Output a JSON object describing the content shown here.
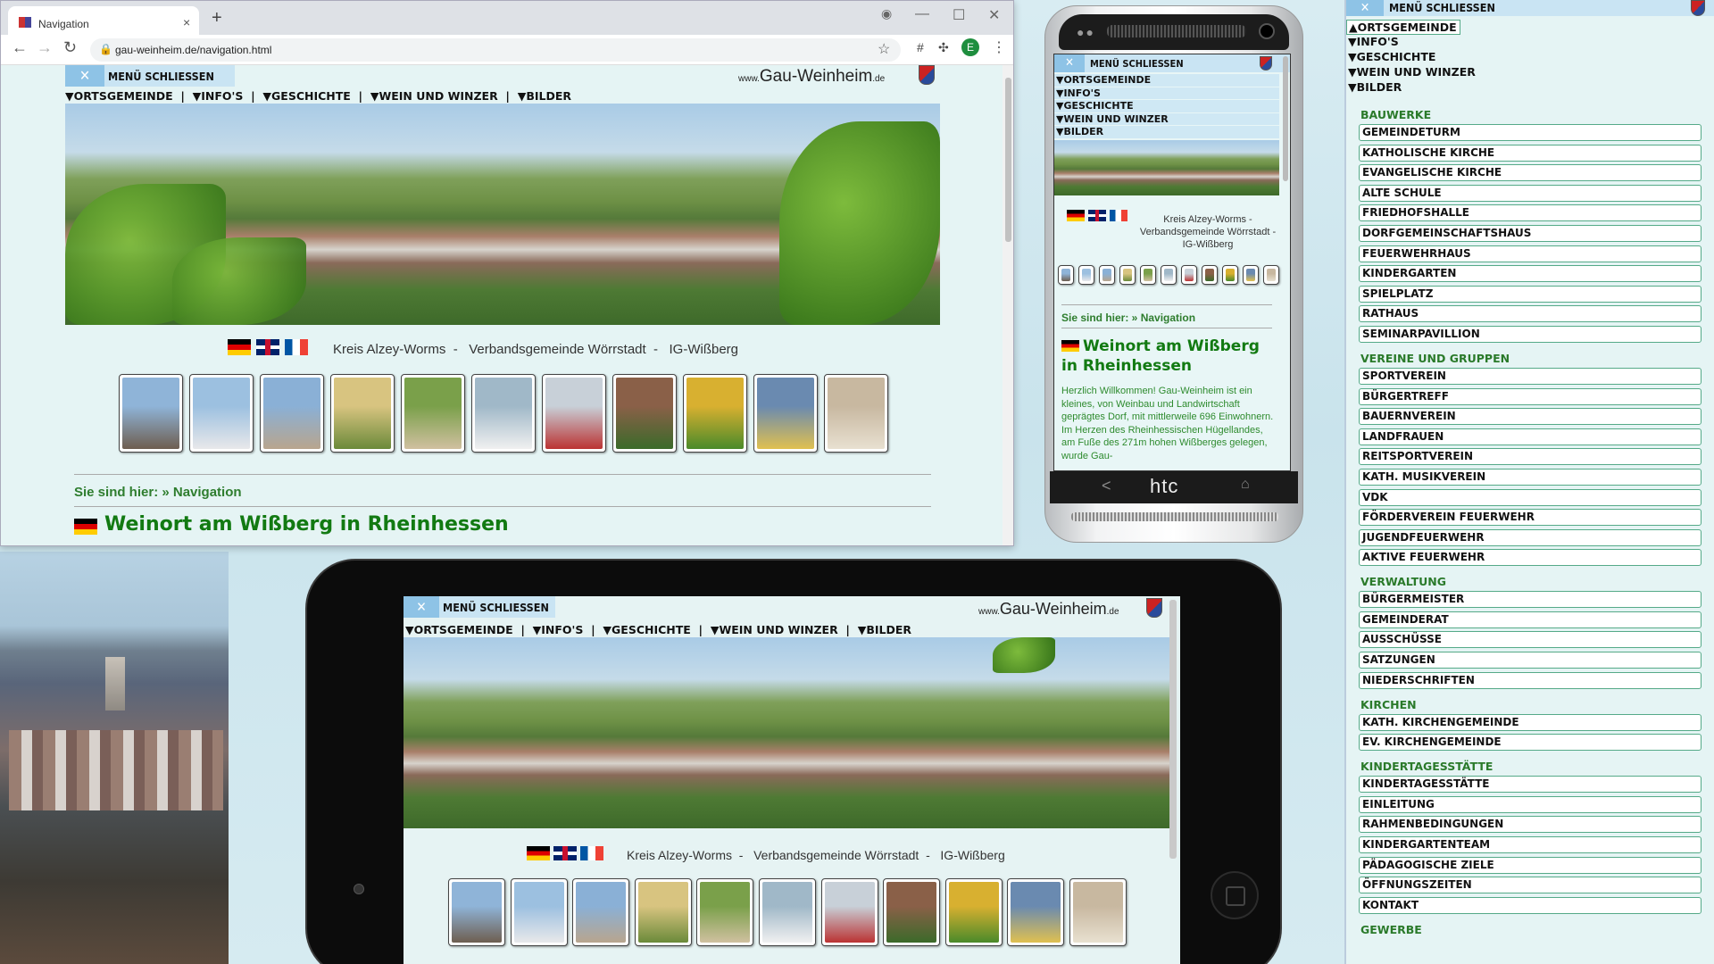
{
  "browser": {
    "tab_title": "Navigation",
    "new_tab": "+",
    "close_tab": "×",
    "url": "gau-weinheim.de/navigation.html",
    "avatar_letter": "E",
    "window_controls": [
      "—",
      "☐",
      "✕"
    ]
  },
  "site": {
    "menu_close": "MENÜ SCHLIESSEN",
    "close_x": "✕",
    "logo_prefix": "www.",
    "logo_name": "Gau-Weinheim",
    "logo_suffix": ".de",
    "nav": [
      "▼ORTSGEMEINDE",
      "|",
      "▼INFO'S",
      "|",
      "▼GESCHICHTE",
      "|",
      "▼WEIN UND WINZER",
      "|",
      "▼BILDER"
    ],
    "region_line": "Kreis Alzey-Worms  -   Verbandsgemeinde Wörrstadt  -   IG-Wißberg",
    "breadcrumb": "Sie sind hier: » Navigation",
    "headline": "Weinort am Wißberg in Rheinhessen",
    "intro": "Herzlich Willkommen! Gau-Weinheim ist ein kleines, von Weinbau und Landwirtschaft geprägtes Dorf, mit mittlerweile 696 Einwohnern. Im Herzen des Rheinhessischen Hügellandes, am Fuße des 271m hohen Wißberges gelegen, wurde Gau-"
  },
  "phone": {
    "nav": [
      "▼ORTSGEMEINDE",
      "▼INFO'S",
      "▼GESCHICHTE",
      "▼WEIN UND WINZER",
      "▼BILDER"
    ],
    "region_line": "Kreis Alzey-Worms  -  Verbandsgemeinde Wörrstadt  -  IG-Wißberg",
    "headline": "Weinort am Wißberg in Rheinhessen",
    "brand": "htc",
    "back": "<",
    "home": "⌂"
  },
  "menu_panel": {
    "close_label": "MENÜ SCHLIESSEN",
    "top_nav": [
      "▲ORTSGEMEINDE",
      "▼INFO'S",
      "▼GESCHICHTE",
      "▼WEIN UND WINZER",
      "▼BILDER"
    ],
    "sections": [
      {
        "title": "BAUWERKE",
        "items": [
          "GEMEINDETURM",
          "KATHOLISCHE KIRCHE",
          "EVANGELISCHE KIRCHE",
          "ALTE SCHULE",
          "FRIEDHOFSHALLE",
          "DORFGEMEINSCHAFTSHAUS",
          "FEUERWEHRHAUS",
          "KINDERGARTEN",
          "SPIELPLATZ",
          "RATHAUS",
          "SEMINARPAVILLION"
        ]
      },
      {
        "title": "VEREINE UND GRUPPEN",
        "items": [
          "SPORTVEREIN",
          "BÜRGERTREFF",
          "BAUERNVEREIN",
          "LANDFRAUEN",
          "REITSPORTVEREIN",
          "KATH. MUSIKVEREIN",
          "VDK",
          "FÖRDERVEREIN FEUERWEHR",
          "JUGENDFEUERWEHR",
          "AKTIVE FEUERWEHR"
        ]
      },
      {
        "title": "VERWALTUNG",
        "items": [
          "BÜRGERMEISTER",
          "GEMEINDERAT",
          "AUSSCHÜSSE",
          "SATZUNGEN",
          "NIEDERSCHRIFTEN"
        ]
      },
      {
        "title": "KIRCHEN",
        "items": [
          "KATH. KIRCHENGEMEINDE",
          "EV. KIRCHENGEMEINDE"
        ]
      },
      {
        "title": "KINDERTAGESSTÄTTE",
        "items": [
          "KINDERTAGESSTÄTTE",
          "EINLEITUNG",
          "RAHMENBEDINGUNGEN",
          "KINDERGARTENTEAM",
          "PÄDAGOGISCHE ZIELE",
          "ÖFFNUNGSZEITEN",
          "KONTAKT"
        ]
      },
      {
        "title": "GEWERBE",
        "items": []
      }
    ]
  },
  "tiles": [
    "tower",
    "church-catholic",
    "church-evangelic",
    "old-school",
    "cemetery-hall",
    "community-house",
    "fire-station",
    "kindergarten",
    "playground",
    "town-hall",
    "pavilion"
  ],
  "colors": {
    "accent_green": "#127a12",
    "menu_blue": "#c9e4f3",
    "page_bg": "#e5f4f4"
  }
}
